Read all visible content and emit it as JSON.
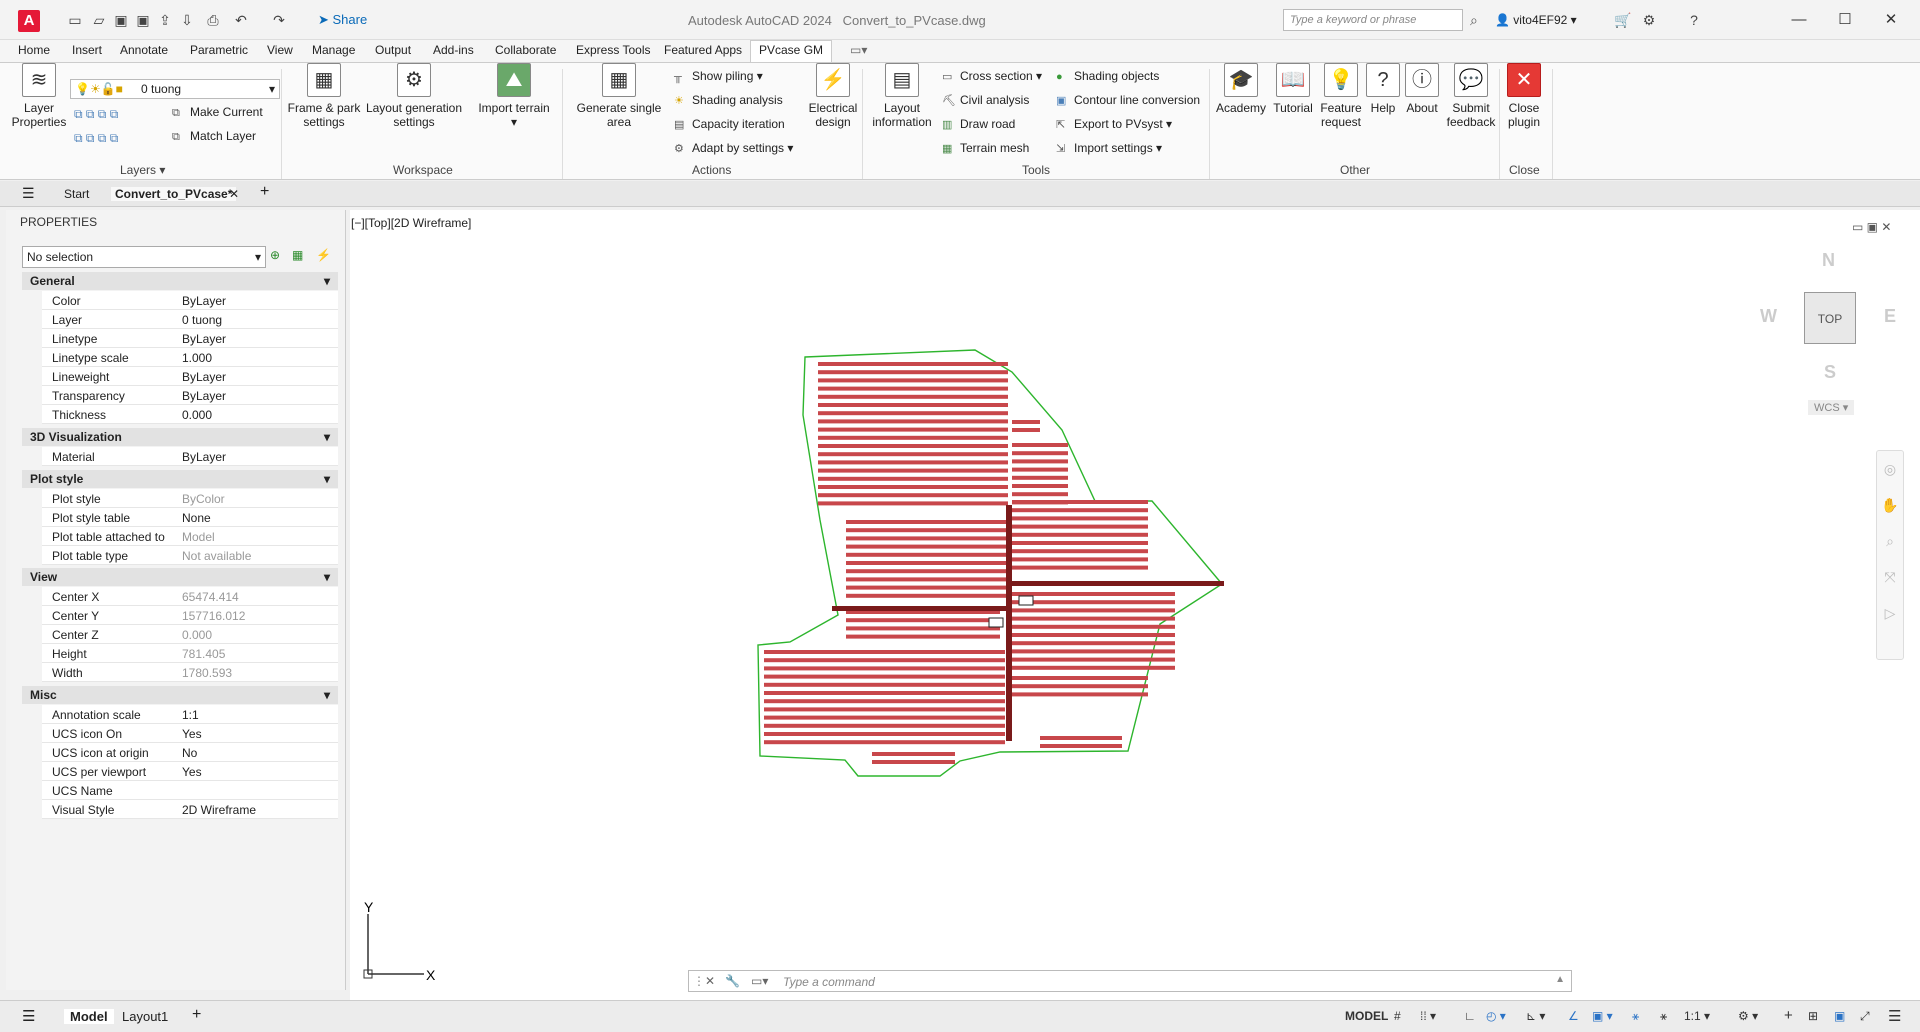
{
  "app": {
    "title": "Autodesk AutoCAD 2024",
    "file": "Convert_to_PVcase.dwg",
    "logo_letter": "A",
    "share_label": "Share",
    "search_placeholder": "Type a keyword or phrase",
    "user": "vito4EF92"
  },
  "ribbon_tabs": [
    "Home",
    "Insert",
    "Annotate",
    "Parametric",
    "View",
    "Manage",
    "Output",
    "Add-ins",
    "Collaborate",
    "Express Tools",
    "Featured Apps",
    "PVcase GM"
  ],
  "active_tab": "PVcase GM",
  "ribbon": {
    "layers": {
      "layer_properties": "Layer Properties",
      "current_layer": "0 tuong",
      "make_current": "Make Current",
      "match_layer": "Match Layer",
      "group_label": "Layers"
    },
    "workspace": {
      "frame_park": "Frame & park settings",
      "layout_generation": "Layout generation settings",
      "import_terrain": "Import terrain",
      "group_label": "Workspace"
    },
    "actions": {
      "generate_single_area": "Generate single area",
      "show_piling": "Show piling",
      "shading_analysis": "Shading analysis",
      "capacity_iteration": "Capacity iteration",
      "adapt_by_settings": "Adapt by settings",
      "electrical_design": "Electrical design",
      "group_label": "Actions"
    },
    "tools": {
      "layout_information": "Layout information",
      "cross_section": "Cross section",
      "civil_analysis": "Civil analysis",
      "draw_road": "Draw road",
      "terrain_mesh": "Terrain mesh",
      "shading_objects": "Shading objects",
      "contour_line_conversion": "Contour line conversion",
      "export_to_pvsyst": "Export to PVsyst",
      "import_settings": "Import settings",
      "group_label": "Tools"
    },
    "other": {
      "academy": "Academy",
      "tutorial": "Tutorial",
      "feature_request": "Feature request",
      "help": "Help",
      "about": "About",
      "submit_feedback": "Submit feedback",
      "group_label": "Other"
    },
    "close": {
      "close_plugin": "Close plugin",
      "group_label": "Close"
    }
  },
  "doc_tabs": {
    "start": "Start",
    "active": "Convert_to_PVcase*"
  },
  "properties": {
    "title": "PROPERTIES",
    "selection": "No selection",
    "sections": {
      "general": "General",
      "viz3d": "3D Visualization",
      "plot_style": "Plot style",
      "view": "View",
      "misc": "Misc"
    },
    "general": [
      {
        "name": "Color",
        "value": "ByLayer"
      },
      {
        "name": "Layer",
        "value": "0 tuong"
      },
      {
        "name": "Linetype",
        "value": "ByLayer"
      },
      {
        "name": "Linetype scale",
        "value": "1.000"
      },
      {
        "name": "Lineweight",
        "value": "ByLayer"
      },
      {
        "name": "Transparency",
        "value": "ByLayer"
      },
      {
        "name": "Thickness",
        "value": "0.000"
      }
    ],
    "viz3d": [
      {
        "name": "Material",
        "value": "ByLayer"
      }
    ],
    "plot_style": [
      {
        "name": "Plot style",
        "value": "ByColor"
      },
      {
        "name": "Plot style table",
        "value": "None"
      },
      {
        "name": "Plot table attached to",
        "value": "Model"
      },
      {
        "name": "Plot table type",
        "value": "Not available"
      }
    ],
    "view": [
      {
        "name": "Center X",
        "value": "65474.414"
      },
      {
        "name": "Center Y",
        "value": "157716.012"
      },
      {
        "name": "Center Z",
        "value": "0.000"
      },
      {
        "name": "Height",
        "value": "781.405"
      },
      {
        "name": "Width",
        "value": "1780.593"
      }
    ],
    "misc": [
      {
        "name": "Annotation scale",
        "value": "1:1"
      },
      {
        "name": "UCS icon On",
        "value": "Yes"
      },
      {
        "name": "UCS icon at origin",
        "value": "No"
      },
      {
        "name": "UCS per viewport",
        "value": "Yes"
      },
      {
        "name": "UCS Name",
        "value": ""
      },
      {
        "name": "Visual Style",
        "value": "2D Wireframe"
      }
    ]
  },
  "viewport": {
    "label": "[−][Top][2D Wireframe]",
    "cube": {
      "n": "N",
      "s": "S",
      "e": "E",
      "w": "W",
      "top": "TOP",
      "wcs": "WCS"
    },
    "ucs": {
      "x": "X",
      "y": "Y"
    }
  },
  "command": {
    "placeholder": "Type a command"
  },
  "status": {
    "model_tab": "Model",
    "layout_tab": "Layout1",
    "model_label": "MODEL",
    "scale": "1:1"
  },
  "colors": {
    "boundary": "#2db52d",
    "rows": "#c8474b",
    "road": "#7a1a1a",
    "close_red": "#e53935"
  }
}
